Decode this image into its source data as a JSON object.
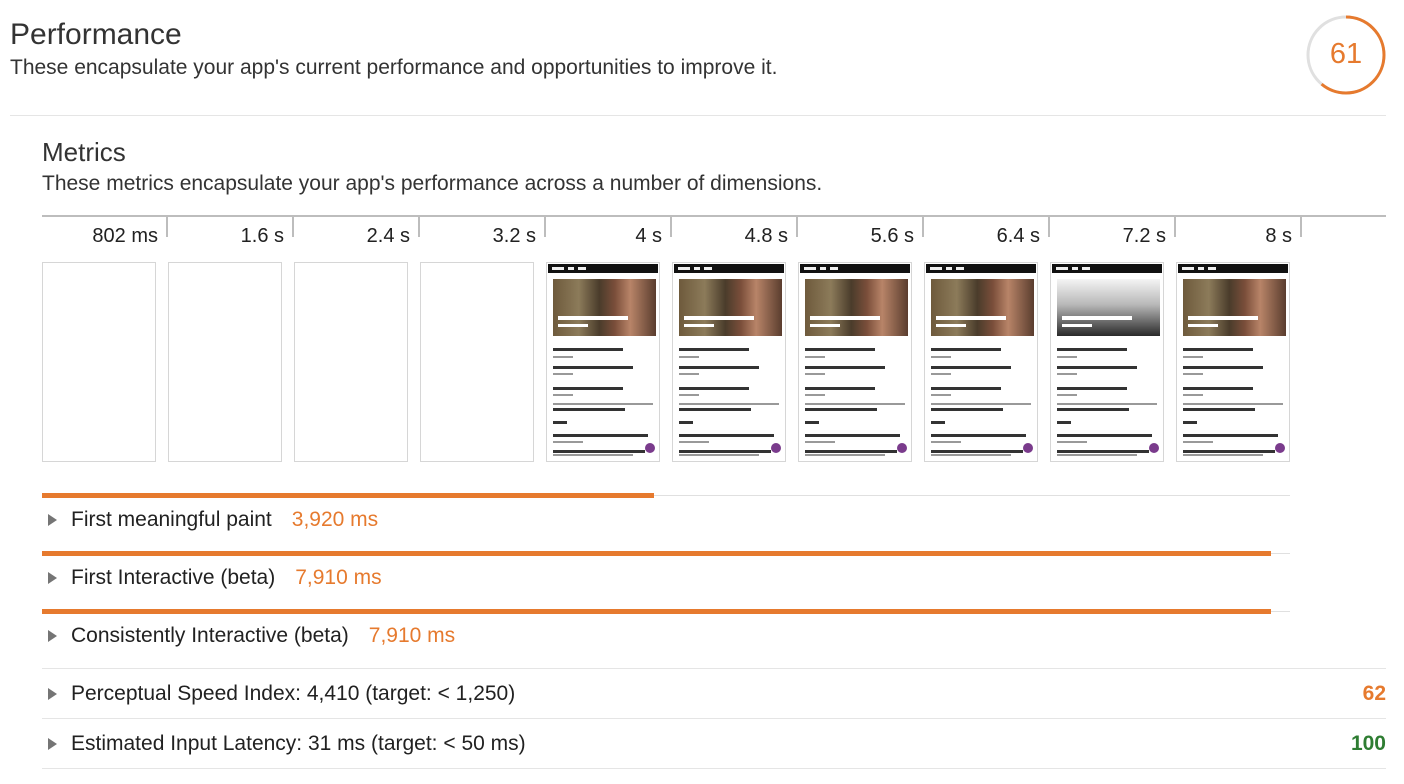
{
  "performance": {
    "title": "Performance",
    "description": "These encapsulate your app's current performance and opportunities to improve it.",
    "score": "61",
    "score_fraction": 0.61,
    "score_color": "#e67a2e"
  },
  "metrics": {
    "title": "Metrics",
    "description": "These metrics encapsulate your app's performance across a number of dimensions."
  },
  "filmstrip": {
    "ticks": [
      "802 ms",
      "1.6 s",
      "2.4 s",
      "3.2 s",
      "4 s",
      "4.8 s",
      "5.6 s",
      "6.4 s",
      "7.2 s",
      "8 s"
    ],
    "frames": [
      "empty",
      "empty",
      "empty",
      "empty",
      "content",
      "content",
      "content",
      "content",
      "loading-hero",
      "content"
    ]
  },
  "metric_rows": [
    {
      "label": "First meaningful paint",
      "value": "3,920 ms",
      "fill_fraction": 0.49
    },
    {
      "label": "First Interactive (beta)",
      "value": "7,910 ms",
      "fill_fraction": 0.985
    },
    {
      "label": "Consistently Interactive (beta)",
      "value": "7,910 ms",
      "fill_fraction": 0.985
    }
  ],
  "audits": [
    {
      "label": "Perceptual Speed Index: 4,410 (target: < 1,250)",
      "score": "62",
      "score_color": "#e67a2e"
    },
    {
      "label": "Estimated Input Latency: 31 ms (target: < 50 ms)",
      "score": "100",
      "score_color": "#2e7d32"
    }
  ]
}
